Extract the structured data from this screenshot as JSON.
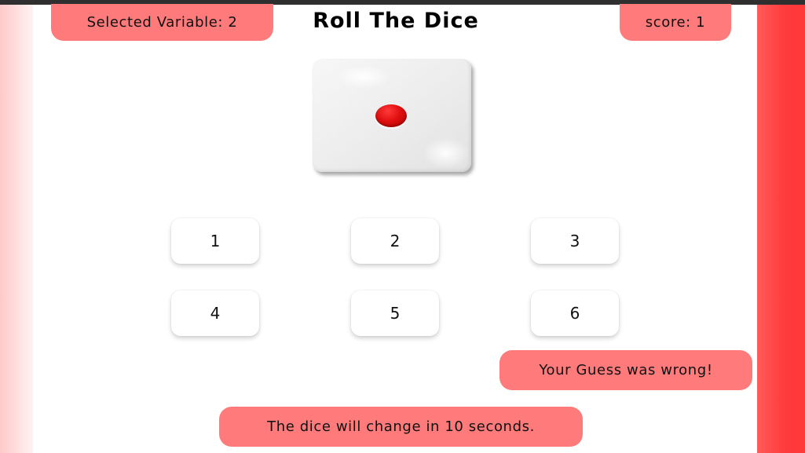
{
  "header": {
    "selected_variable": "Selected Variable: 2",
    "title": "Roll The Dice",
    "score": "score: 1"
  },
  "die": {
    "face_value": 1,
    "pip_color": "#e01010"
  },
  "choices": {
    "b1": "1",
    "b2": "2",
    "b3": "3",
    "b4": "4",
    "b5": "5",
    "b6": "6"
  },
  "messages": {
    "result": "Your Guess was wrong!",
    "timer": "The dice will change in 10 seconds."
  },
  "colors": {
    "pill": "#ff7b7b",
    "right_band": "#ff3a3a",
    "left_band": "#ffc9c9"
  }
}
